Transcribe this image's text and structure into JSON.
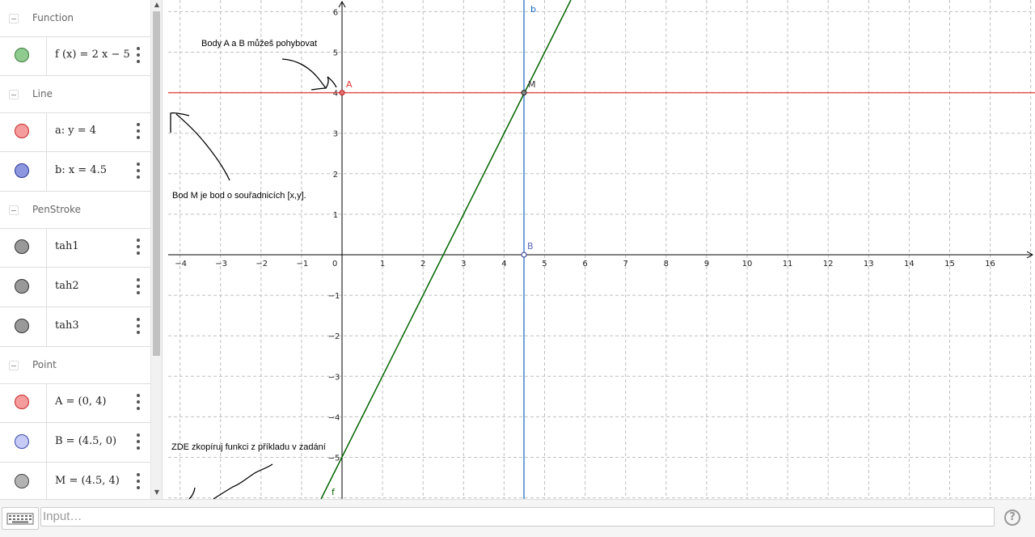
{
  "algebra": {
    "groups": [
      {
        "title": "Function",
        "items": [
          {
            "label": "f (x)  =  2 x − 5",
            "color": "#8fca8f"
          }
        ]
      },
      {
        "title": "Line",
        "items": [
          {
            "label": "a: y  =  4",
            "color": "#f59c9c"
          },
          {
            "label": "b: x  =  4.5",
            "color": "#8c97e0"
          }
        ]
      },
      {
        "title": "PenStroke",
        "items": [
          {
            "label": "tah1",
            "color": "#999999"
          },
          {
            "label": "tah2",
            "color": "#999999"
          },
          {
            "label": "tah3",
            "color": "#999999"
          }
        ]
      },
      {
        "title": "Point",
        "items": [
          {
            "label": "A  =  (0, 4)",
            "color": "#f59c9c"
          },
          {
            "label": "B  =  (4.5, 0)",
            "color": "#c5cbf5"
          },
          {
            "label": "M  =  (4.5, 4)",
            "color": "#b3b3b3"
          }
        ]
      }
    ]
  },
  "graphics": {
    "x_ticks": [
      "−4",
      "−3",
      "−2",
      "−1",
      "0",
      "1",
      "2",
      "3",
      "4",
      "5",
      "6",
      "7",
      "8",
      "9",
      "10",
      "11",
      "12",
      "13",
      "14",
      "15",
      "16"
    ],
    "y_ticks": [
      "6",
      "5",
      "4",
      "3",
      "2",
      "1",
      "−1",
      "−2",
      "−3",
      "−4",
      "−5"
    ],
    "point_labels": {
      "A": "A",
      "B": "B",
      "M": "M"
    },
    "line_labels": {
      "b": "b",
      "f": "f"
    },
    "texts": {
      "note1": "Body A a B můžeš pohybovat",
      "note2": "Bod M je bod o souřadnicích [x,y].",
      "note3": "ZDE zkopíruj funkci z příkladu v zadání"
    },
    "colors": {
      "function": "#006400",
      "line_a": "#e53935",
      "line_b": "#1565c0",
      "grid": "#c0c0c0"
    }
  },
  "inputbar": {
    "placeholder": "Input…",
    "help": "?"
  }
}
